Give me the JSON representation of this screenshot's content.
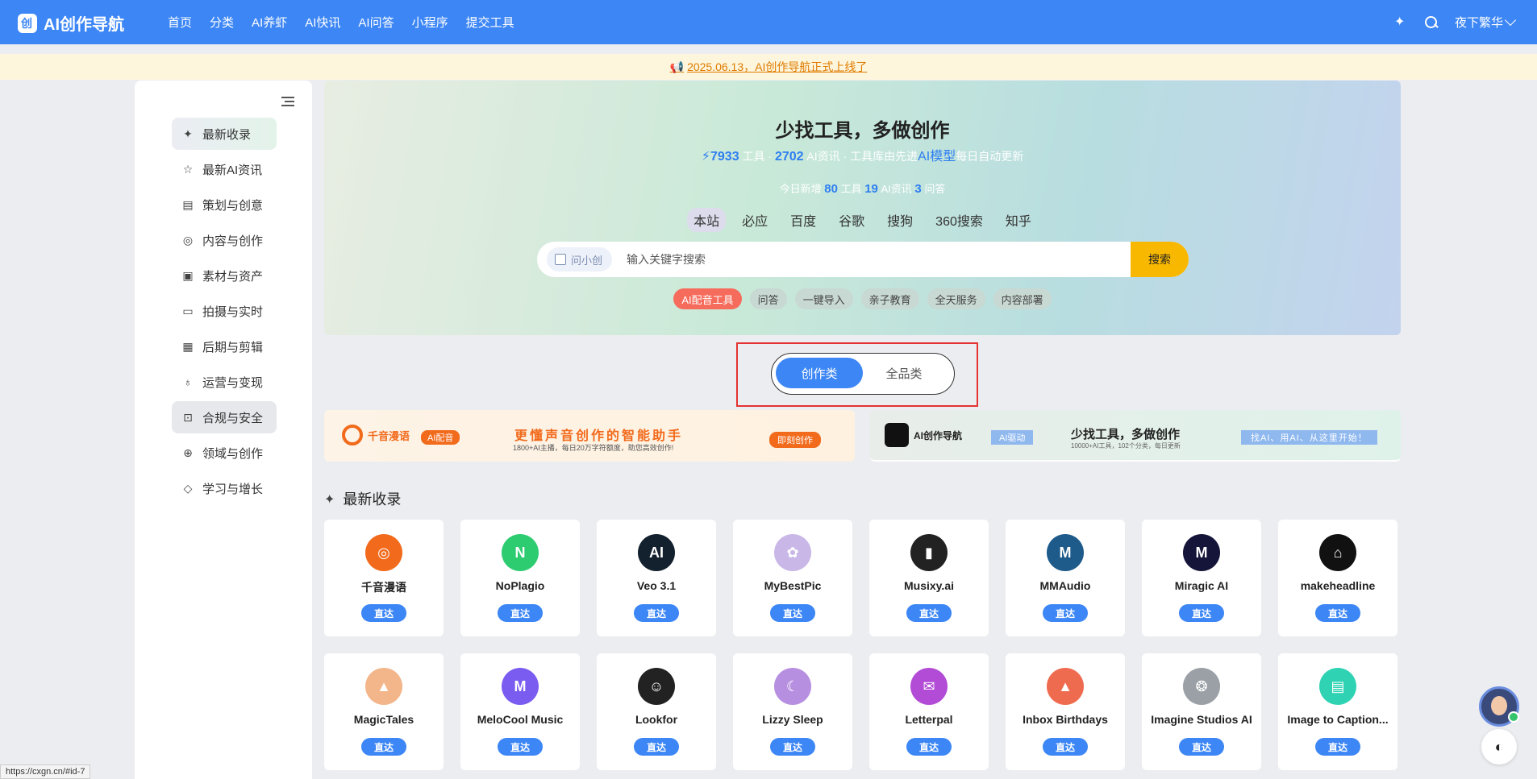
{
  "brand": {
    "name": "AI创作导航"
  },
  "nav": {
    "items": [
      "首页",
      "分类",
      "AI养虾",
      "AI快讯",
      "AI问答",
      "小程序",
      "提交工具"
    ]
  },
  "top_right": {
    "lang_label": "夜下繁华",
    "icons": [
      "sparkle-icon",
      "search-icon",
      "chevron-down-icon"
    ]
  },
  "announcement": {
    "text": "2025.06.13，AI创作导航正式上线了"
  },
  "sidebar": {
    "items": [
      {
        "label": "最新收录",
        "icon": "✦"
      },
      {
        "label": "最新AI资讯",
        "icon": "☆"
      },
      {
        "label": "策划与创意",
        "icon": "▤"
      },
      {
        "label": "内容与创作",
        "icon": "◎"
      },
      {
        "label": "素材与资产",
        "icon": "▣"
      },
      {
        "label": "拍摄与实时",
        "icon": "▭"
      },
      {
        "label": "后期与剪辑",
        "icon": "▦"
      },
      {
        "label": "运营与变现",
        "icon": "♁"
      },
      {
        "label": "合规与安全",
        "icon": "⊡"
      },
      {
        "label": "领域与创作",
        "icon": "⊕"
      },
      {
        "label": "学习与增长",
        "icon": "◇"
      }
    ]
  },
  "hero": {
    "title": "少找工具，多做创作",
    "stats": {
      "bolt": "⚡",
      "tools": "7933",
      "tools_label": "工具 · ",
      "news": "2702",
      "news_label": "AI资讯 · 工具库由先进",
      "model": "AI模型",
      "suffix": "每日自动更新"
    },
    "today": {
      "prefix": "今日新增",
      "tools": "80",
      "tools_label": "工具",
      "news": "19",
      "news_label": "AI资讯",
      "qa": "3",
      "qa_label": "问答"
    },
    "engines": [
      "本站",
      "必应",
      "百度",
      "谷歌",
      "搜狗",
      "360搜索",
      "知乎"
    ],
    "search": {
      "ask_label": "问小创",
      "placeholder": "输入关键字搜索",
      "button": "搜索"
    },
    "tags": [
      "AI配音工具",
      "问答",
      "一键导入",
      "亲子教育",
      "全天服务",
      "内容部署"
    ]
  },
  "toggle": {
    "active": "创作类",
    "inactive": "全品类"
  },
  "banners": {
    "b1": {
      "logo": "千音漫语",
      "badge": "AI配音",
      "title": "更懂声音创作的智能助手",
      "sub": "1800+AI主播，每日20万字符额度，助您高效创作!",
      "button": "即刻创作"
    },
    "b2": {
      "logo": "AI创作导航",
      "badge": "AI驱动",
      "title": "少找工具，多做创作",
      "sub": "10000+AI工具，102个分类，每日更新",
      "tag": "找AI、用AI、从这里开始！"
    }
  },
  "section": {
    "title": "最新收录"
  },
  "cards": [
    {
      "name": "千音漫语",
      "logo": "◎",
      "color": "#f26a1b",
      "go": "直达"
    },
    {
      "name": "NoPlagio",
      "logo": "N",
      "color": "#2ecc71",
      "go": "直达"
    },
    {
      "name": "Veo 3.1",
      "logo": "AI",
      "color": "#13202e",
      "go": "直达"
    },
    {
      "name": "MyBestPic",
      "logo": "✿",
      "color": "#c9b7e8",
      "go": "直达"
    },
    {
      "name": "Musixy.ai",
      "logo": "▮",
      "color": "#222222",
      "go": "直达"
    },
    {
      "name": "MMAudio",
      "logo": "M",
      "color": "#1e5a8a",
      "go": "直达"
    },
    {
      "name": "Miragic AI",
      "logo": "M",
      "color": "#15153a",
      "go": "直达"
    },
    {
      "name": "makeheadline",
      "logo": "⌂",
      "color": "#111111",
      "go": "直达"
    },
    {
      "name": "MagicTales",
      "logo": "▲",
      "color": "#f3b58a",
      "go": "直达"
    },
    {
      "name": "MeloCool Music",
      "logo": "M",
      "color": "#7b5cf0",
      "go": "直达"
    },
    {
      "name": "Lookfor",
      "logo": "☺",
      "color": "#222222",
      "go": "直达"
    },
    {
      "name": "Lizzy Sleep",
      "logo": "☾",
      "color": "#b78fe0",
      "go": "直达"
    },
    {
      "name": "Letterpal",
      "logo": "✉",
      "color": "#b24bd6",
      "go": "直达"
    },
    {
      "name": "Inbox Birthdays",
      "logo": "▲",
      "color": "#ef6b50",
      "go": "直达"
    },
    {
      "name": "Imagine Studios AI",
      "logo": "❂",
      "color": "#9aa0a6",
      "go": "直达"
    },
    {
      "name": "Image to Caption...",
      "logo": "▤",
      "color": "#2fd3b3",
      "go": "直达"
    }
  ],
  "floating": {
    "theme_icon": "◐"
  },
  "statusbar": {
    "url": "https://cxgn.cn/#id-7"
  }
}
